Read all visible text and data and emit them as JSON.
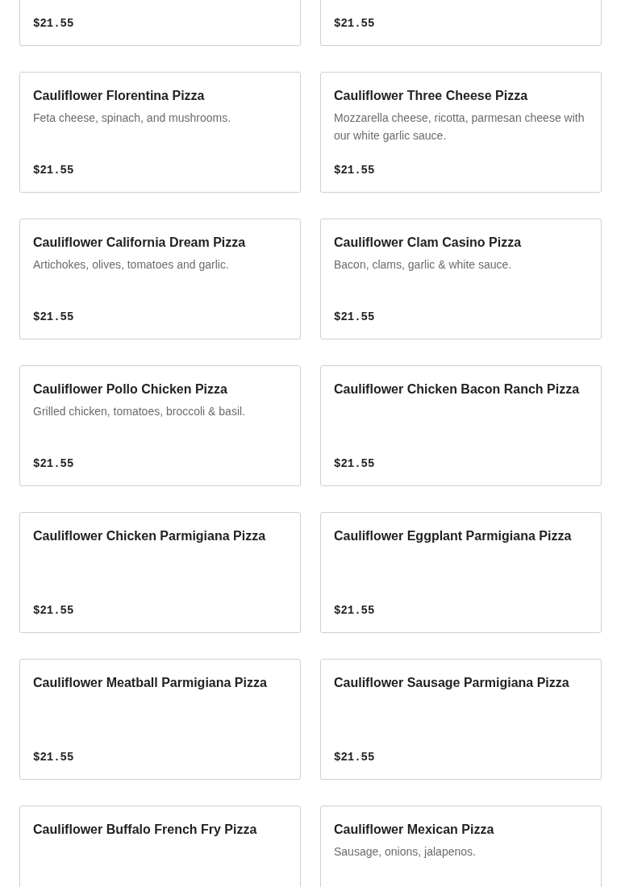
{
  "items": [
    {
      "price": "$21.55"
    },
    {
      "price": "$21.55"
    },
    {
      "name": "Cauliflower Florentina Pizza",
      "description": "Feta cheese, spinach, and mushrooms.",
      "price": "$21.55"
    },
    {
      "name": "Cauliflower Three Cheese Pizza",
      "description": "Mozzarella cheese, ricotta, parmesan cheese with our white garlic sauce.",
      "price": "$21.55"
    },
    {
      "name": "Cauliflower California Dream Pizza",
      "description": "Artichokes, olives, tomatoes and garlic.",
      "price": "$21.55"
    },
    {
      "name": "Cauliflower Clam Casino Pizza",
      "description": "Bacon, clams, garlic & white sauce.",
      "price": "$21.55"
    },
    {
      "name": "Cauliflower Pollo Chicken Pizza",
      "description": "Grilled chicken, tomatoes, broccoli & basil.",
      "price": "$21.55"
    },
    {
      "name": "Cauliflower Chicken Bacon Ranch Pizza",
      "price": "$21.55"
    },
    {
      "name": "Cauliflower Chicken Parmigiana Pizza",
      "price": "$21.55"
    },
    {
      "name": "Cauliflower Eggplant Parmigiana Pizza",
      "price": "$21.55"
    },
    {
      "name": "Cauliflower Meatball Parmigiana Pizza",
      "price": "$21.55"
    },
    {
      "name": "Cauliflower Sausage Parmigiana Pizza",
      "price": "$21.55"
    },
    {
      "name": "Cauliflower Buffalo French Fry Pizza"
    },
    {
      "name": "Cauliflower Mexican Pizza",
      "description": "Sausage, onions, jalapenos."
    }
  ]
}
